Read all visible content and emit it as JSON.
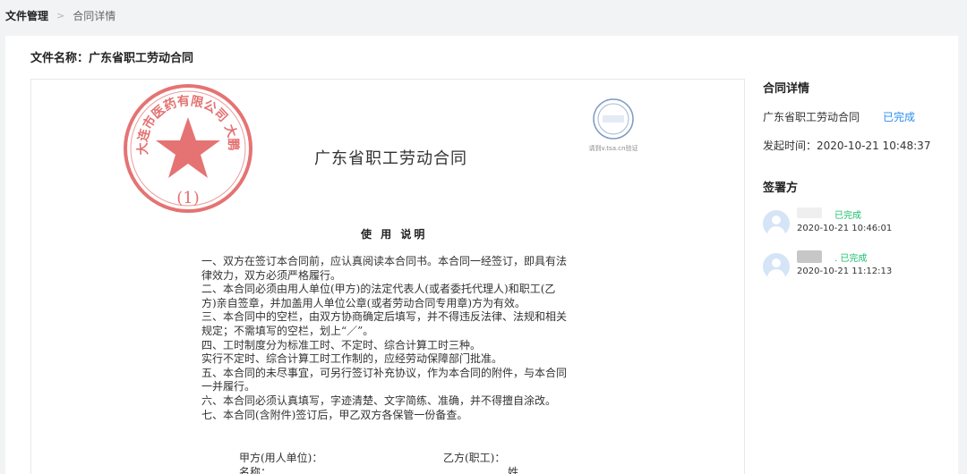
{
  "breadcrumb": {
    "root": "文件管理",
    "separator": ">",
    "current": "合同详情"
  },
  "file": {
    "label": "文件名称：",
    "name": "广东省职工劳动合同"
  },
  "document": {
    "title": "广东省职工劳动合同",
    "seal_number": "(1)",
    "seal_text": "大连市医药有限公司  大鹏药集团",
    "timestamp_caption": "请到v.tsa.cn验证",
    "usage_heading": "使 用 说明",
    "rules": [
      "一、双方在签订本合同前，应认真阅读本合同书。本合同一经签订，即具有法",
      "律效力，双方必须严格履行。",
      "二、本合同必须由用人单位(甲方)的法定代表人(或者委托代理人)和职工(乙",
      "方)亲自签章，并加盖用人单位公章(或者劳动合同专用章)方为有效。",
      "三、本合同中的空栏，由双方协商确定后填写，并不得违反法律、法规和相关",
      "规定；不需填写的空栏，划上“／”。",
      "四、工时制度分为标准工时、不定时、综合计算工时三种。",
      "实行不定时、综合计算工时工作制的，应经劳动保障部门批准。",
      "五、本合同的未尽事宜，可另行签订补充协议，作为本合同的附件，与本合同",
      "一并履行。",
      "六、本合同必须认真填写，字迹清楚、文字简练、准确，并不得擅自涂改。",
      "七、本合同(含附件)签订后，甲乙双方各保管一份备查。"
    ],
    "party_a": "甲方(用人单位)：",
    "party_b": "乙方(职工)：",
    "name_label": "名称：",
    "surname_label": "姓"
  },
  "sidebar": {
    "details_heading": "合同详情",
    "contract_name": "广东省职工劳动合同",
    "contract_status": "已完成",
    "sent_time": "发起时间：2020-10-21 10:48:37",
    "signers_heading": "签署方",
    "signers": [
      {
        "status": "已完成",
        "time": "2020-10-21 10:46:01"
      },
      {
        "status": ". 已完成",
        "time": "2020-10-21 11:12:13"
      }
    ]
  },
  "colors": {
    "accent_blue": "#2d8cf0",
    "success_green": "#19be6b",
    "seal_red": "#e05a5a"
  }
}
